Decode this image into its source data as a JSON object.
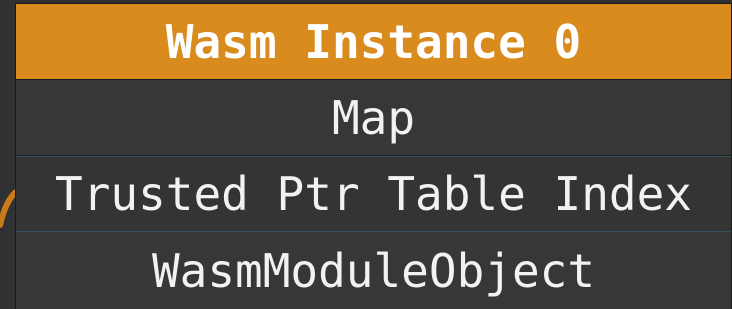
{
  "node": {
    "title": "Wasm Instance 0",
    "fields": [
      "Map",
      "Trusted Ptr Table Index",
      "WasmModuleObject"
    ]
  },
  "colors": {
    "background": "#303132",
    "header": "#d98b1e",
    "row": "#373737",
    "text": "#f2f2f2",
    "edge": "#c97a1a"
  }
}
